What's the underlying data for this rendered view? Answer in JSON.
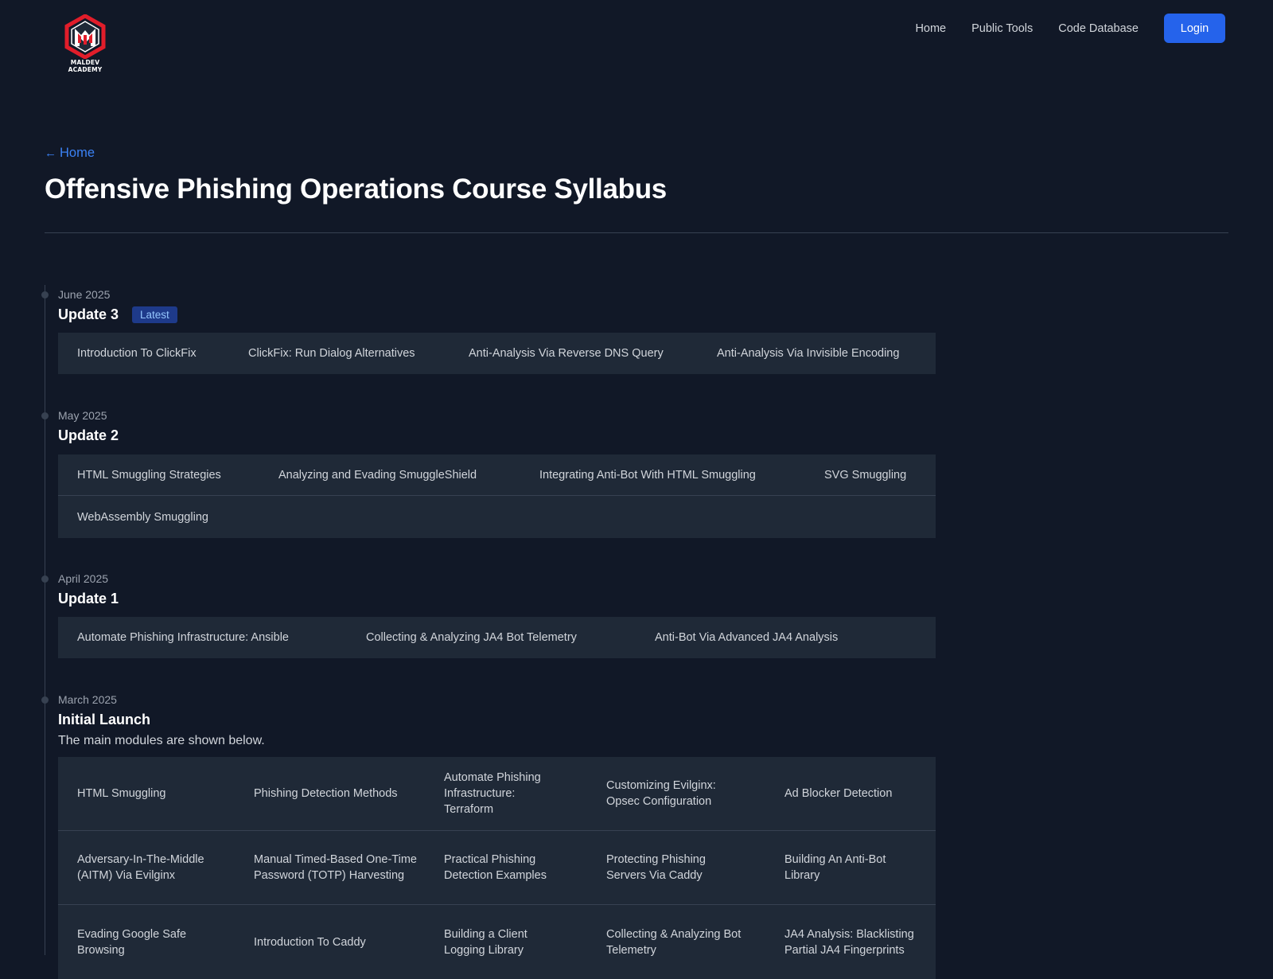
{
  "header": {
    "logo_text_line1": "MALDEV",
    "logo_text_line2": "ACADEMY",
    "nav": [
      "Home",
      "Public Tools",
      "Code Database"
    ],
    "login_label": "Login"
  },
  "back_link": "Home",
  "page_title": "Offensive Phishing Operations Course Syllabus",
  "updates": [
    {
      "date": "June 2025",
      "title": "Update 3",
      "badge": "Latest",
      "rows": [
        [
          "Introduction To ClickFix",
          "ClickFix: Run Dialog Alternatives",
          "Anti-Analysis Via Reverse DNS Query",
          "Anti-Analysis Via Invisible Encoding"
        ]
      ]
    },
    {
      "date": "May 2025",
      "title": "Update 2",
      "rows": [
        [
          "HTML Smuggling Strategies",
          "Analyzing and Evading SmuggleShield",
          "Integrating Anti-Bot With HTML Smuggling",
          "SVG Smuggling"
        ],
        [
          "WebAssembly Smuggling"
        ]
      ]
    },
    {
      "date": "April 2025",
      "title": "Update 1",
      "rows": [
        [
          "Automate Phishing Infrastructure: Ansible",
          "Collecting & Analyzing JA4 Bot Telemetry",
          "Anti-Bot Via Advanced JA4 Analysis"
        ]
      ]
    },
    {
      "date": "March 2025",
      "title": "Initial Launch",
      "description": "The main modules are shown below.",
      "rows": [
        [
          "HTML Smuggling",
          "Phishing Detection Methods",
          "Automate Phishing Infrastructure: Terraform",
          "Customizing Evilginx: Opsec Configuration",
          "Ad Blocker Detection"
        ],
        [
          "Adversary-In-The-Middle (AITM) Via Evilginx",
          "Manual Timed-Based One-Time Password (TOTP) Harvesting",
          "Practical Phishing Detection Examples",
          "Protecting Phishing Servers Via Caddy",
          "Building An Anti-Bot Library"
        ],
        [
          "Evading Google Safe Browsing",
          "Introduction To Caddy",
          "Building a Client Logging Library",
          "Collecting & Analyzing Bot Telemetry",
          "JA4 Analysis: Blacklisting Partial JA4 Fingerprints"
        ]
      ]
    }
  ]
}
